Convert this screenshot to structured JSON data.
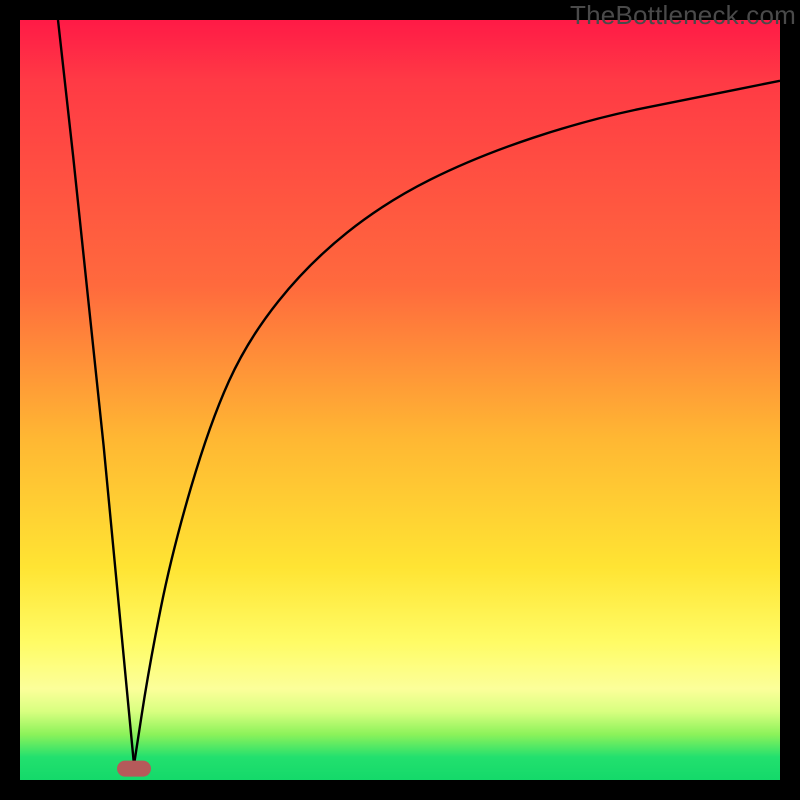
{
  "watermark": "TheBottleneck.com",
  "chart_data": {
    "type": "line",
    "title": "",
    "xlabel": "",
    "ylabel": "",
    "xlim": [
      0,
      100
    ],
    "ylim": [
      0,
      100
    ],
    "note": "Axes are unlabeled; values are read as percent of plot width/height. y=0 is the bottom (green), y=100 is the top (red). Two curves dip to a shared minimum near x≈15.",
    "series": [
      {
        "name": "left-branch",
        "x": [
          5,
          7,
          9,
          11,
          13,
          15
        ],
        "y": [
          100,
          82,
          63,
          44,
          23,
          2
        ]
      },
      {
        "name": "right-branch",
        "x": [
          15,
          17,
          20,
          25,
          30,
          38,
          48,
          60,
          75,
          90,
          100
        ],
        "y": [
          2,
          15,
          30,
          47,
          58,
          68,
          76,
          82,
          87,
          90,
          92
        ]
      }
    ],
    "marker": {
      "x": 15,
      "y": 1.5,
      "shape": "pill",
      "color": "#b55a5a"
    },
    "background_gradient": {
      "stops": [
        {
          "pos": 0.0,
          "color": "#ff1a46"
        },
        {
          "pos": 0.55,
          "color": "#ffb733"
        },
        {
          "pos": 0.82,
          "color": "#fffc66"
        },
        {
          "pos": 0.97,
          "color": "#22e06e"
        },
        {
          "pos": 1.0,
          "color": "#14d96a"
        }
      ]
    }
  }
}
